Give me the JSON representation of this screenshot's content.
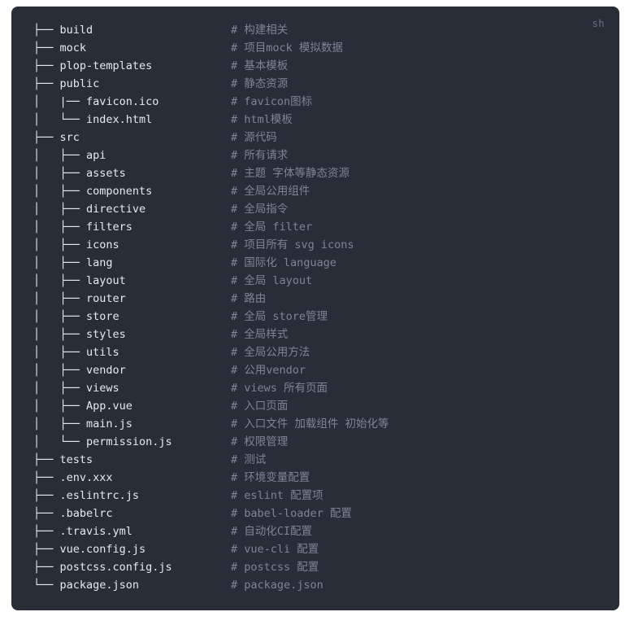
{
  "code_block": {
    "language_label": "sh",
    "colors": {
      "background": "#282d38",
      "page_background": "#ffffff",
      "text": "#e6e9ef",
      "comment": "#7d8596",
      "language_label": "#6b7280"
    },
    "lines": [
      {
        "tree": "├── build",
        "comment": "# 构建相关"
      },
      {
        "tree": "├── mock",
        "comment": "# 项目mock 模拟数据"
      },
      {
        "tree": "├── plop-templates",
        "comment": "# 基本模板"
      },
      {
        "tree": "├── public",
        "comment": "# 静态资源"
      },
      {
        "tree": "│   |── favicon.ico",
        "comment": "# favicon图标"
      },
      {
        "tree": "│   └── index.html",
        "comment": "# html模板"
      },
      {
        "tree": "├── src",
        "comment": "# 源代码"
      },
      {
        "tree": "│   ├── api",
        "comment": "# 所有请求"
      },
      {
        "tree": "│   ├── assets",
        "comment": "# 主题 字体等静态资源"
      },
      {
        "tree": "│   ├── components",
        "comment": "# 全局公用组件"
      },
      {
        "tree": "│   ├── directive",
        "comment": "# 全局指令"
      },
      {
        "tree": "│   ├── filters",
        "comment": "# 全局 filter"
      },
      {
        "tree": "│   ├── icons",
        "comment": "# 项目所有 svg icons"
      },
      {
        "tree": "│   ├── lang",
        "comment": "# 国际化 language"
      },
      {
        "tree": "│   ├── layout",
        "comment": "# 全局 layout"
      },
      {
        "tree": "│   ├── router",
        "comment": "# 路由"
      },
      {
        "tree": "│   ├── store",
        "comment": "# 全局 store管理"
      },
      {
        "tree": "│   ├── styles",
        "comment": "# 全局样式"
      },
      {
        "tree": "│   ├── utils",
        "comment": "# 全局公用方法"
      },
      {
        "tree": "│   ├── vendor",
        "comment": "# 公用vendor"
      },
      {
        "tree": "│   ├── views",
        "comment": "# views 所有页面"
      },
      {
        "tree": "│   ├── App.vue",
        "comment": "# 入口页面"
      },
      {
        "tree": "│   ├── main.js",
        "comment": "# 入口文件 加载组件 初始化等"
      },
      {
        "tree": "│   └── permission.js",
        "comment": "# 权限管理"
      },
      {
        "tree": "├── tests",
        "comment": "# 测试"
      },
      {
        "tree": "├── .env.xxx",
        "comment": "# 环境变量配置"
      },
      {
        "tree": "├── .eslintrc.js",
        "comment": "# eslint 配置项"
      },
      {
        "tree": "├── .babelrc",
        "comment": "# babel-loader 配置"
      },
      {
        "tree": "├── .travis.yml",
        "comment": "# 自动化CI配置"
      },
      {
        "tree": "├── vue.config.js",
        "comment": "# vue-cli 配置"
      },
      {
        "tree": "├── postcss.config.js",
        "comment": "# postcss 配置"
      },
      {
        "tree": "└── package.json",
        "comment": "# package.json"
      }
    ]
  }
}
